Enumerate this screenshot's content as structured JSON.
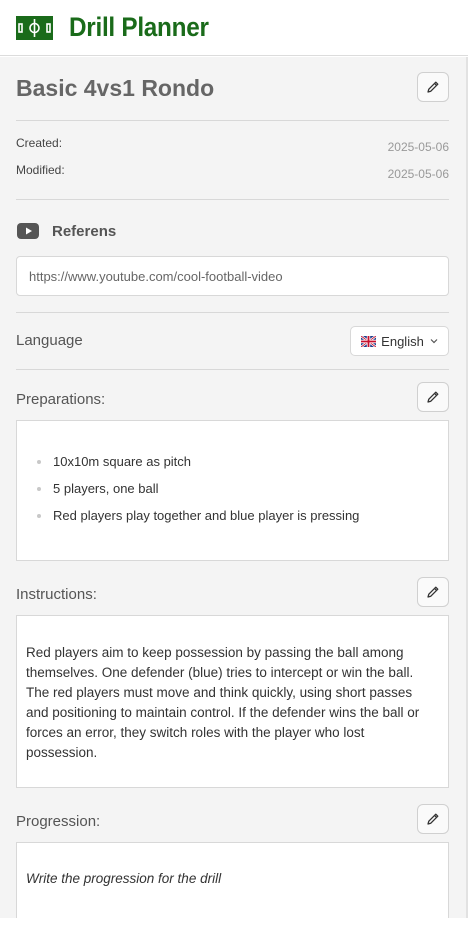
{
  "app": {
    "title": "Drill Planner",
    "logo_icon": "football-pitch-icon",
    "brand_color": "#1a6b1a"
  },
  "drill": {
    "title": "Basic 4vs1 Rondo",
    "created_label": "Created:",
    "created_value": "2025-05-06",
    "modified_label": "Modified:",
    "modified_value": "2025-05-06"
  },
  "reference": {
    "icon": "youtube-icon",
    "label": "Referens",
    "url": "https://www.youtube.com/cool-football-video"
  },
  "language": {
    "label": "Language",
    "flag_icon": "uk-flag-icon",
    "selected": "English"
  },
  "preparations": {
    "label": "Preparations:",
    "items": [
      "10x10m square as pitch",
      "5 players, one ball",
      "Red players play together and blue player is pressing"
    ]
  },
  "instructions": {
    "label": "Instructions:",
    "text": "Red players aim to keep possession by passing the ball among themselves. One defender (blue) tries to intercept or win the ball. The red players must move and think quickly, using short passes and positioning to maintain control. If the defender wins the ball or forces an error, they switch roles with the player who lost possession."
  },
  "progression": {
    "label": "Progression:",
    "placeholder": "Write the progression for the drill"
  }
}
